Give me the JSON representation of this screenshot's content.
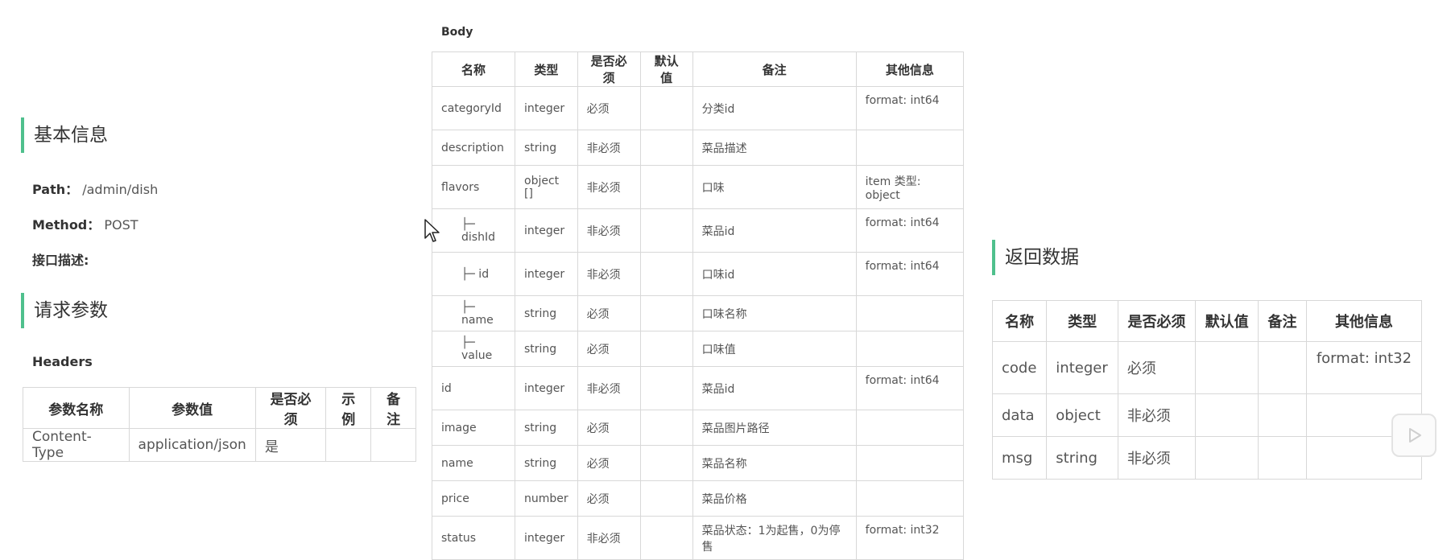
{
  "basic": {
    "title": "基本信息",
    "path_label": "Path：",
    "path_value": "/admin/dish",
    "method_label": "Method：",
    "method_value": "POST",
    "desc_label": "接口描述:"
  },
  "request": {
    "title": "请求参数",
    "headers_label": "Headers",
    "headers_columns": [
      "参数名称",
      "参数值",
      "是否必须",
      "示例",
      "备注"
    ],
    "headers_rows": [
      [
        "Content-Type",
        "application/json",
        "是",
        "",
        ""
      ]
    ]
  },
  "body": {
    "label": "Body",
    "columns": [
      "名称",
      "类型",
      "是否必须",
      "默认值",
      "备注",
      "其他信息"
    ],
    "rows": [
      {
        "name": "categoryId",
        "type": "integer",
        "required": "必须",
        "default": "",
        "remark": "分类id",
        "other": "format: int64"
      },
      {
        "name": "description",
        "type": "string",
        "required": "非必须",
        "default": "",
        "remark": "菜品描述",
        "other": ""
      },
      {
        "name": "flavors",
        "type": "object []",
        "required": "非必须",
        "default": "",
        "remark": "口味",
        "other": "item 类型: object"
      },
      {
        "name": "├─ dishId",
        "type": "integer",
        "required": "非必须",
        "default": "",
        "remark": "菜品id",
        "other": "format: int64"
      },
      {
        "name": "├─ id",
        "type": "integer",
        "required": "非必须",
        "default": "",
        "remark": "口味id",
        "other": "format: int64"
      },
      {
        "name": "├─ name",
        "type": "string",
        "required": "必须",
        "default": "",
        "remark": "口味名称",
        "other": ""
      },
      {
        "name": "├─ value",
        "type": "string",
        "required": "必须",
        "default": "",
        "remark": "口味值",
        "other": ""
      },
      {
        "name": "id",
        "type": "integer",
        "required": "非必须",
        "default": "",
        "remark": "菜品id",
        "other": "format: int64"
      },
      {
        "name": "image",
        "type": "string",
        "required": "必须",
        "default": "",
        "remark": "菜品图片路径",
        "other": ""
      },
      {
        "name": "name",
        "type": "string",
        "required": "必须",
        "default": "",
        "remark": "菜品名称",
        "other": ""
      },
      {
        "name": "price",
        "type": "number",
        "required": "必须",
        "default": "",
        "remark": "菜品价格",
        "other": ""
      },
      {
        "name": "status",
        "type": "integer",
        "required": "非必须",
        "default": "",
        "remark": "菜品状态：1为起售，0为停售",
        "other": "format: int32"
      }
    ]
  },
  "response": {
    "title": "返回数据",
    "columns": [
      "名称",
      "类型",
      "是否必须",
      "默认值",
      "备注",
      "其他信息"
    ],
    "rows": [
      {
        "name": "code",
        "type": "integer",
        "required": "必须",
        "default": "",
        "remark": "",
        "other": "format: int32"
      },
      {
        "name": "data",
        "type": "object",
        "required": "非必须",
        "default": "",
        "remark": "",
        "other": ""
      },
      {
        "name": "msg",
        "type": "string",
        "required": "非必须",
        "default": "",
        "remark": "",
        "other": ""
      }
    ]
  },
  "icons": {
    "cursor": "mouse-pointer-icon",
    "play": "play-icon"
  }
}
